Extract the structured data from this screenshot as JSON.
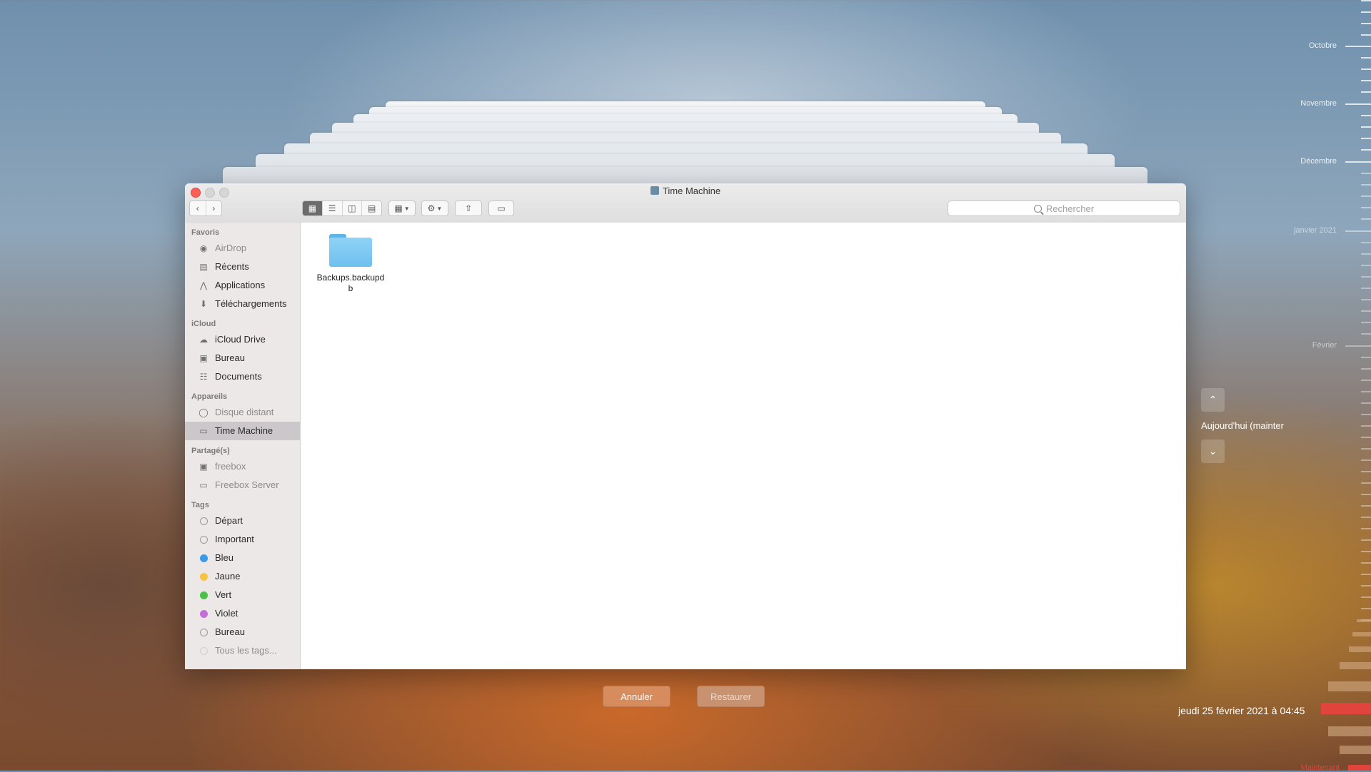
{
  "window": {
    "title": "Time Machine",
    "search_placeholder": "Rechercher"
  },
  "sidebar": {
    "sections": {
      "favoris": "Favoris",
      "icloud": "iCloud",
      "appareils": "Appareils",
      "partages": "Partagé(s)",
      "tags": "Tags"
    },
    "favoris": [
      "AirDrop",
      "Récents",
      "Applications",
      "Téléchargements"
    ],
    "icloud": [
      "iCloud Drive",
      "Bureau",
      "Documents"
    ],
    "appareils": [
      "Disque distant",
      "Time Machine"
    ],
    "partages": [
      "freebox",
      "Freebox Server"
    ],
    "tags": [
      {
        "label": "Départ",
        "color": ""
      },
      {
        "label": "Important",
        "color": ""
      },
      {
        "label": "Bleu",
        "color": "#3b9ae8"
      },
      {
        "label": "Jaune",
        "color": "#f6c344"
      },
      {
        "label": "Vert",
        "color": "#4cc045"
      },
      {
        "label": "Violet",
        "color": "#c36fd7"
      },
      {
        "label": "Bureau",
        "color": ""
      },
      {
        "label": "Tous les tags...",
        "color": ""
      }
    ]
  },
  "content": {
    "folder_name": "Backups.backupdb"
  },
  "buttons": {
    "cancel": "Annuler",
    "restore": "Restaurer"
  },
  "timeline": {
    "months": [
      "Octobre",
      "Novembre",
      "Décembre",
      "janvier 2021",
      "Février"
    ],
    "today_label": "Aujourd'hui (mainter",
    "current_date": "jeudi 25 février 2021 à 04:45",
    "now_label": "Maintenant"
  },
  "colors": {
    "accent_button": "#d78c5e",
    "now_marker": "#e0443c",
    "close_button": "#fc5f57"
  }
}
